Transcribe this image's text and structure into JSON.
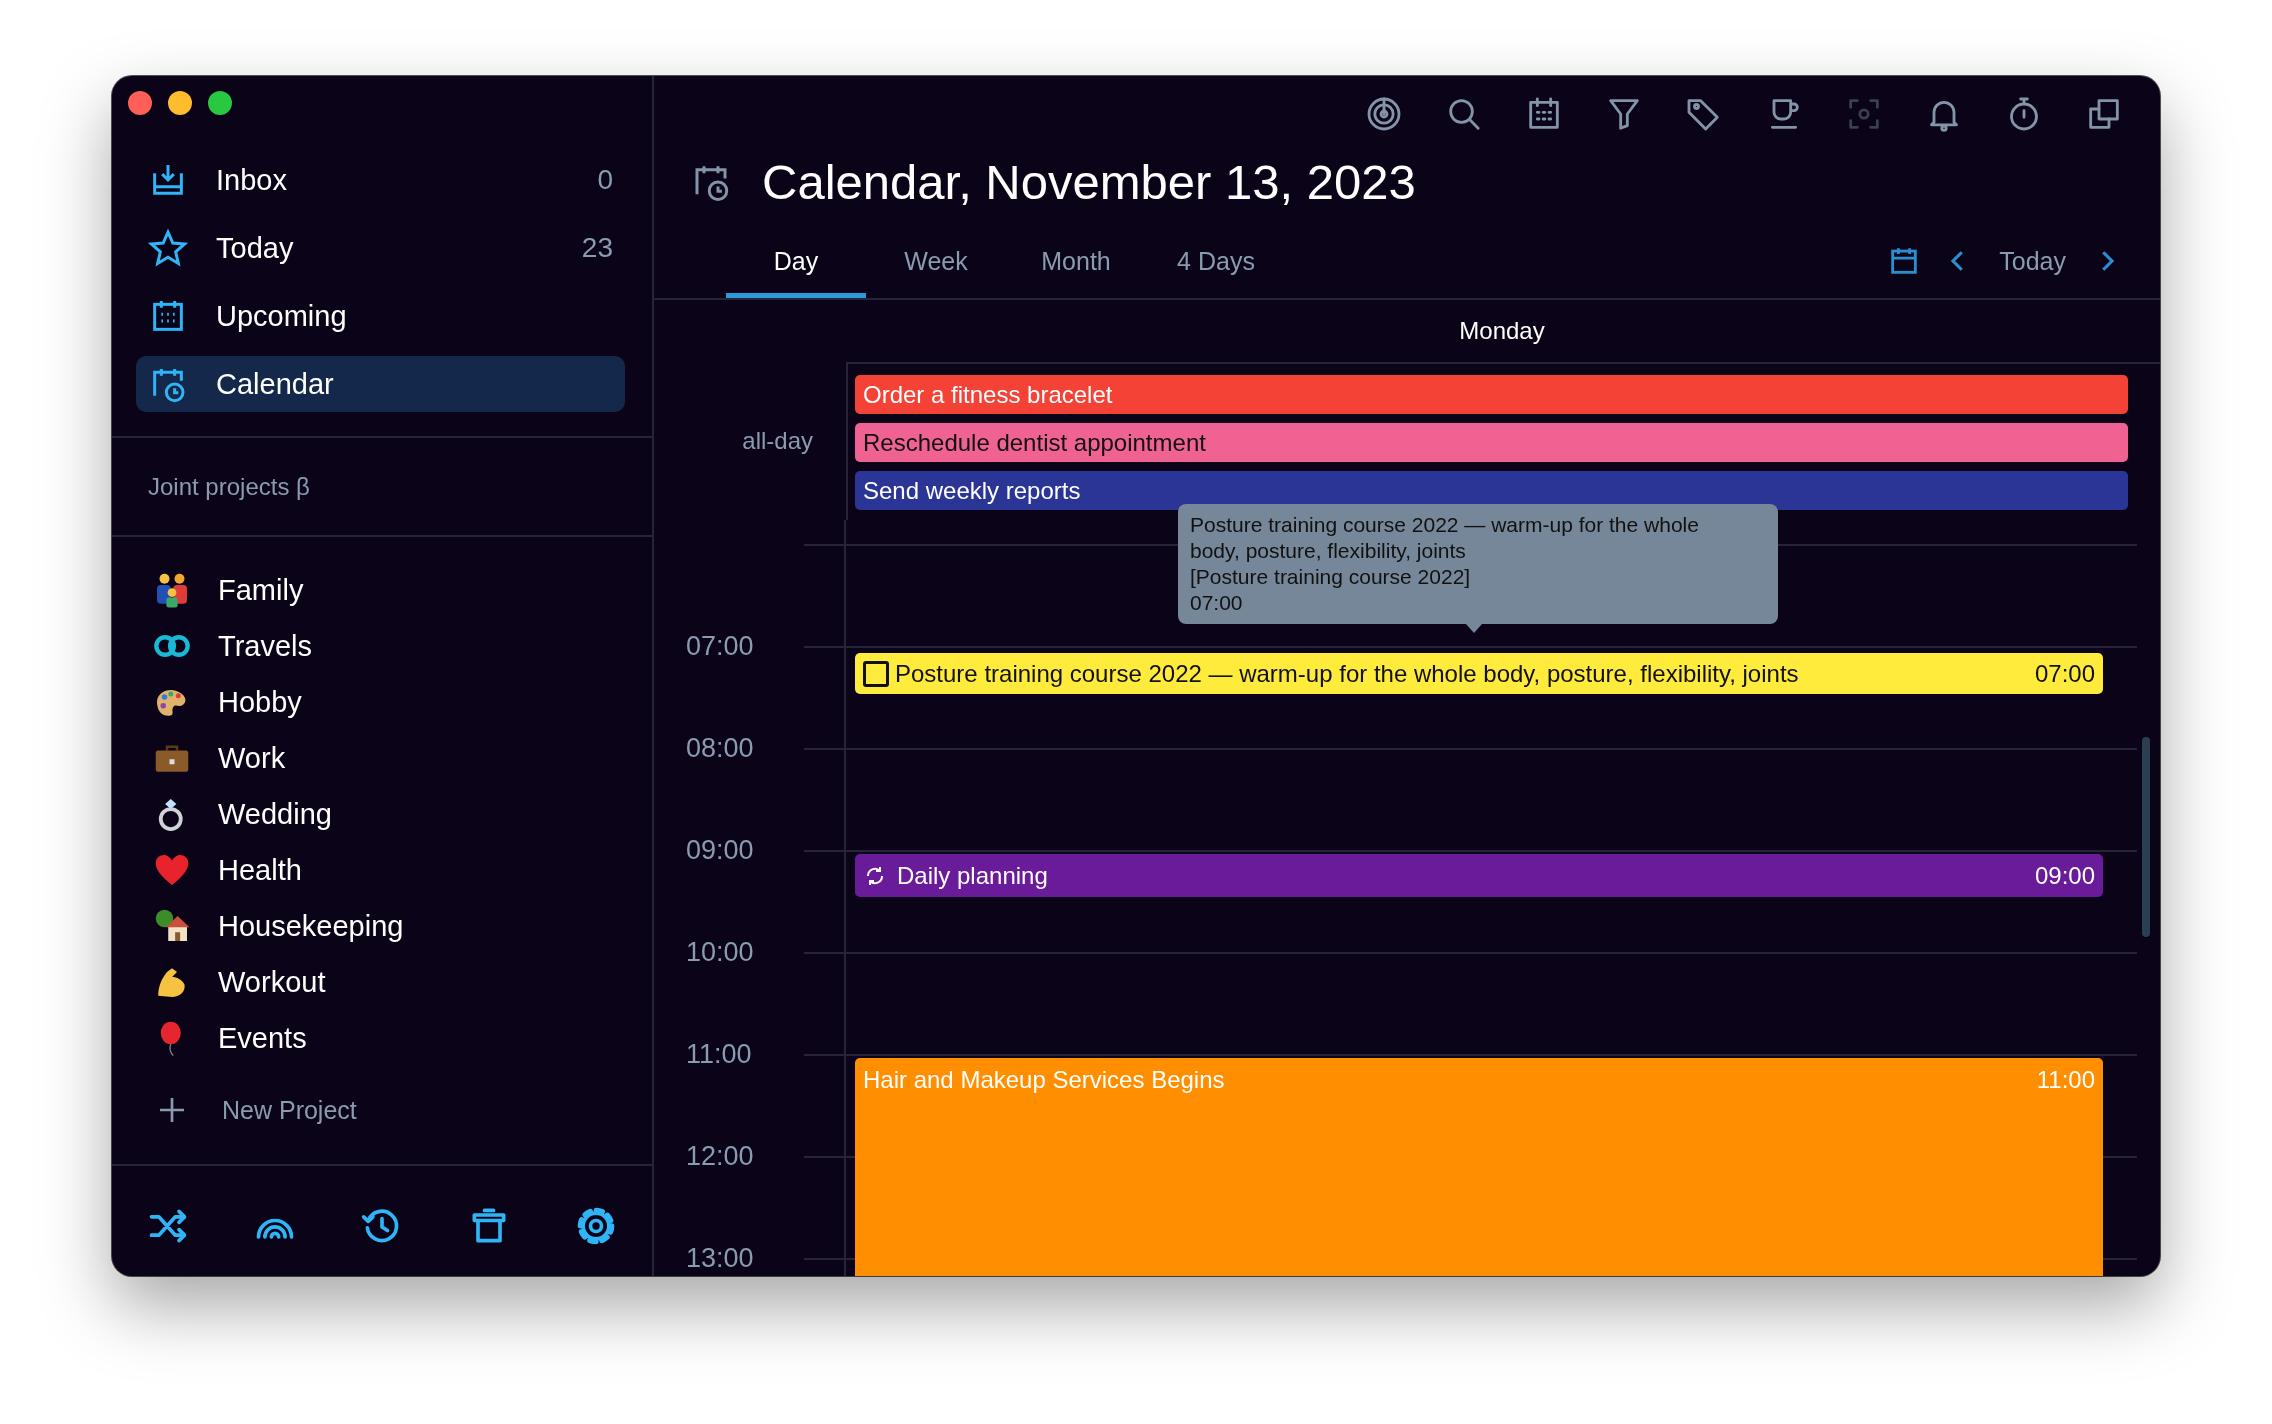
{
  "sidebar": {
    "nav": [
      {
        "label": "Inbox",
        "count": "0",
        "selected": false
      },
      {
        "label": "Today",
        "count": "23",
        "selected": false
      },
      {
        "label": "Upcoming",
        "selected": false
      },
      {
        "label": "Calendar",
        "selected": true
      }
    ],
    "section_title": "Joint projects β",
    "projects": [
      {
        "label": "Family"
      },
      {
        "label": "Travels"
      },
      {
        "label": "Hobby"
      },
      {
        "label": "Work"
      },
      {
        "label": "Wedding"
      },
      {
        "label": "Health"
      },
      {
        "label": "Housekeeping"
      },
      {
        "label": "Workout"
      },
      {
        "label": "Events"
      }
    ],
    "new_project": "New Project"
  },
  "toolbar": [
    {
      "disabled": false
    },
    {
      "disabled": false
    },
    {
      "disabled": false
    },
    {
      "disabled": false
    },
    {
      "disabled": false
    },
    {
      "disabled": false
    },
    {
      "disabled": true
    },
    {
      "disabled": false
    },
    {
      "disabled": false
    },
    {
      "disabled": false
    }
  ],
  "title": "Calendar, November 13, 2023",
  "tabs": [
    {
      "label": "Day",
      "selected": true
    },
    {
      "label": "Week",
      "selected": false
    },
    {
      "label": "Month",
      "selected": false
    },
    {
      "label": "4 Days",
      "selected": false
    }
  ],
  "nav_today": "Today",
  "day_header": "Monday",
  "all_day": {
    "label": "all-day",
    "events": [
      {
        "title": "Order a fitness bracelet",
        "color": "#f44336",
        "dark_text": false
      },
      {
        "title": "Reschedule dentist appointment",
        "color": "#f06292",
        "dark_text": true
      },
      {
        "title": "Send weekly reports",
        "color": "#2b3595",
        "dark_text": false
      }
    ]
  },
  "hours": [
    {
      "label": "07:00",
      "events": [
        {
          "kind": "task",
          "title": "Posture training course 2022 — warm-up for the whole body, posture, flexibility, joints",
          "time": "07:00",
          "color": "#ffeb3b",
          "dark_text": true,
          "checked": false
        }
      ]
    },
    {
      "label": "08:00"
    },
    {
      "label": "09:00",
      "events": [
        {
          "kind": "recurring",
          "title": "Daily planning",
          "time": "09:00",
          "color": "#6a1b9a",
          "dark_text": false
        }
      ]
    },
    {
      "label": "10:00"
    },
    {
      "label": "11:00",
      "events": [
        {
          "kind": "event",
          "title": "Hair and Makeup Services Begins",
          "time": "11:00",
          "color": "#ff8f00",
          "dark_text": false
        }
      ]
    },
    {
      "label": "12:00"
    },
    {
      "label": "13:00"
    }
  ],
  "tooltip": {
    "title": "Posture training course 2022 — warm-up for the whole body, posture, flexibility, joints",
    "project": "[Posture training course 2022]",
    "time": "07:00"
  }
}
